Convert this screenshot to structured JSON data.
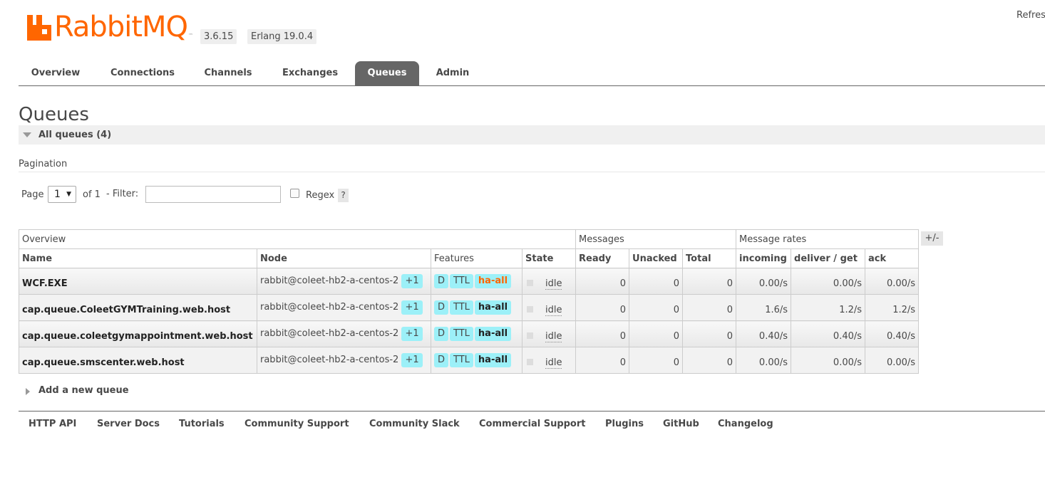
{
  "header": {
    "logo_text": "RabbitMQ",
    "trademark": "™",
    "version": "3.6.15",
    "erlang": "Erlang 19.0.4",
    "refresh_label": "Refres"
  },
  "nav": {
    "tabs": [
      {
        "label": "Overview"
      },
      {
        "label": "Connections"
      },
      {
        "label": "Channels"
      },
      {
        "label": "Exchanges"
      },
      {
        "label": "Queues"
      },
      {
        "label": "Admin"
      }
    ],
    "active": "Queues"
  },
  "main": {
    "title": "Queues",
    "section_label": "All queues (4)",
    "pagination_label": "Pagination",
    "page_label": "Page",
    "page_value": "1",
    "of_label": "of 1",
    "filter_label": "- Filter:",
    "filter_value": "",
    "regex_label": "Regex",
    "help_label": "?",
    "plusminus_label": "+/-",
    "add_queue_label": "Add a new queue"
  },
  "table": {
    "groups": [
      "Overview",
      "Messages",
      "Message rates"
    ],
    "columns": [
      "Name",
      "Node",
      "Features",
      "State",
      "Ready",
      "Unacked",
      "Total",
      "incoming",
      "deliver / get",
      "ack"
    ],
    "rows": [
      {
        "name": "WCF.EXE",
        "node": "rabbit@coleet-hb2-a-centos-2",
        "mirror": "+1",
        "features": [
          "D",
          "TTL"
        ],
        "policy": "ha-all",
        "state": "idle",
        "ready": "0",
        "unacked": "0",
        "total": "0",
        "incoming": "0.00/s",
        "deliver": "0.00/s",
        "ack": "0.00/s"
      },
      {
        "name": "cap.queue.ColeetGYMTraining.web.host",
        "node": "rabbit@coleet-hb2-a-centos-2",
        "mirror": "+1",
        "features": [
          "D",
          "TTL"
        ],
        "policy": "ha-all",
        "state": "idle",
        "ready": "0",
        "unacked": "0",
        "total": "0",
        "incoming": "1.6/s",
        "deliver": "1.2/s",
        "ack": "1.2/s"
      },
      {
        "name": "cap.queue.coleetgymappointment.web.host",
        "node": "rabbit@coleet-hb2-a-centos-2",
        "mirror": "+1",
        "features": [
          "D",
          "TTL"
        ],
        "policy": "ha-all",
        "state": "idle",
        "ready": "0",
        "unacked": "0",
        "total": "0",
        "incoming": "0.40/s",
        "deliver": "0.40/s",
        "ack": "0.40/s"
      },
      {
        "name": "cap.queue.smscenter.web.host",
        "node": "rabbit@coleet-hb2-a-centos-2",
        "mirror": "+1",
        "features": [
          "D",
          "TTL"
        ],
        "policy": "ha-all",
        "state": "idle",
        "ready": "0",
        "unacked": "0",
        "total": "0",
        "incoming": "0.00/s",
        "deliver": "0.00/s",
        "ack": "0.00/s"
      }
    ]
  },
  "footer": {
    "links": [
      "HTTP API",
      "Server Docs",
      "Tutorials",
      "Community Support",
      "Community Slack",
      "Commercial Support",
      "Plugins",
      "GitHub",
      "Changelog"
    ]
  },
  "colors": {
    "brand": "#ff6600",
    "badge": "#9cf0f8",
    "active_tab": "#666666"
  }
}
